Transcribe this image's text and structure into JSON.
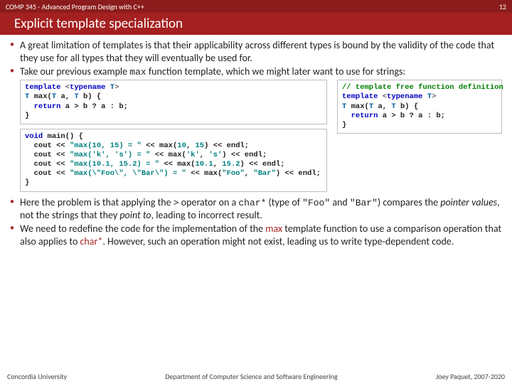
{
  "header": {
    "course": "COMP 345 - Advanced Program Design with C++",
    "page_number": "12",
    "title": "Explicit template specialization"
  },
  "bullets": {
    "b1": "A great limitation of templates is that their applicability across different types is bound by the validity of the code that they use for all types that they will eventually be used for.",
    "b2a": "Take our previous example ",
    "b2_fn": "max",
    "b2b": " function template, which we might later want to use for strings:",
    "b3a": "Here the problem is that applying the ",
    "b3_op": ">",
    "b3b": " operator on a ",
    "b3_type": "char*",
    "b3c": " (type of ",
    "b3_foo": "\"Foo\"",
    "b3d": " and ",
    "b3_bar": "\"Bar\"",
    "b3e": ") compares the ",
    "b3_pv": "pointer values",
    "b3f": ", not the strings that they ",
    "b3_pt": "point to",
    "b3g": ", leading to incorrect result.",
    "b4a": "We need to redefine the code for the implementation of the ",
    "b4_max": "max",
    "b4b": " template function to use a comparison operation that also applies to ",
    "b4_char": "char*",
    "b4c": ". However, such an operation might not exist, leading us to write type-dependent code."
  },
  "code_left1": {
    "l1_a": "template",
    "l1_b": " <",
    "l1_c": "typename",
    "l1_d": " ",
    "l1_e": "T",
    "l1_f": ">",
    "l2_a": "T",
    "l2_b": " max(",
    "l2_c": "T",
    "l2_d": " a, ",
    "l2_e": "T",
    "l2_f": " b) {",
    "l3_a": "  ",
    "l3_b": "return",
    "l3_c": " a > b ? a : b;",
    "l4": "}"
  },
  "code_left2": {
    "l1_a": "void",
    "l1_b": " main() {",
    "l2_a": "  cout << ",
    "l2_b": "\"max(10, 15) = \"",
    "l2_c": " << max(",
    "l2_d": "10",
    "l2_e": ", ",
    "l2_f": "15",
    "l2_g": ") << endl;",
    "l3_a": "  cout << ",
    "l3_b": "\"max('k', 's') = \"",
    "l3_c": " << max(",
    "l3_d": "'k'",
    "l3_e": ", ",
    "l3_f": "'s'",
    "l3_g": ") << endl;",
    "l4_a": "  cout << ",
    "l4_b": "\"max(10.1, 15.2) = \"",
    "l4_c": " << max(",
    "l4_d": "10.1",
    "l4_e": ", ",
    "l4_f": "15.2",
    "l4_g": ") << endl;",
    "l5_a": "  cout << ",
    "l5_b": "\"max(\\\"Foo\\\", \\\"Bar\\\") = \"",
    "l5_c": " << max(",
    "l5_d": "\"Foo\"",
    "l5_e": ", ",
    "l5_f": "\"Bar\"",
    "l5_g": ") << endl;",
    "l6": "}"
  },
  "code_right": {
    "c1": "// template free function definition",
    "l1_a": "template",
    "l1_b": " <",
    "l1_c": "typename",
    "l1_d": " ",
    "l1_e": "T",
    "l1_f": ">",
    "l2_a": "T",
    "l2_b": " max(",
    "l2_c": "T",
    "l2_d": " a, ",
    "l2_e": "T",
    "l2_f": " b) {",
    "l3_a": "  ",
    "l3_b": "return",
    "l3_c": " a > b ? a : b;",
    "l4": "}"
  },
  "footer": {
    "left": "Concordia University",
    "center": "Department of Computer Science and Software Engineering",
    "right": "Joey Paquet, 2007-2020"
  }
}
